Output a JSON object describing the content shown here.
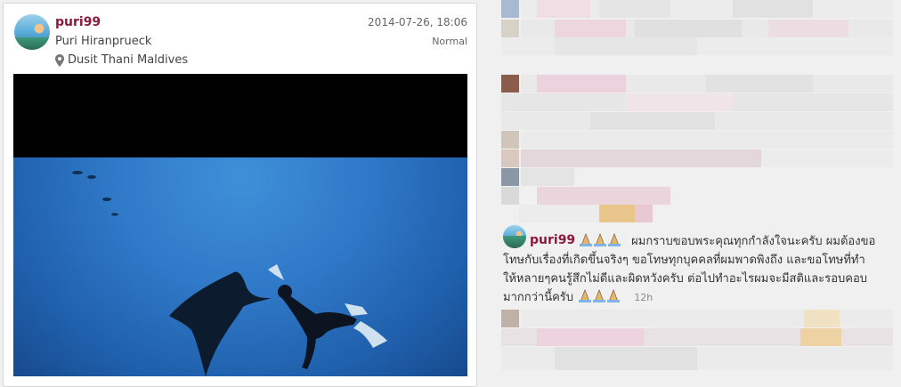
{
  "post": {
    "username": "puri99",
    "full_name": "Puri Hiranprueck",
    "location": "Dusit Thani Maldives",
    "timestamp": "2014-07-26, 18:06",
    "filter": "Normal"
  },
  "comment": {
    "username": "puri99",
    "text_line1": "ผมกราบขอบพระคุณทุกกำลังใจนะครับ ผมต้องขอ",
    "text_line2": "โทษกับเรื่องที่เกิดขึ้นจริงๆ ขอโทษทุกบุคคลที่ผมพาดพิงถึง และขอโทษที่ทำ",
    "text_line3": "ให้หลายๆคนรู้สึกไม่ดีและผิดหวังครับ ต่อไปทำอะไรผมจะมีสติและรอบคอบ",
    "text_line4": "มากกว่านี้ครับ",
    "age": "12h",
    "emoji": "folded-hands-icon"
  },
  "colors": {
    "username": "#8b1a3d",
    "sea": "#2f79c8",
    "mosaic_pink": "#e6c9d3",
    "mosaic_gray": "#dcdcdc"
  }
}
